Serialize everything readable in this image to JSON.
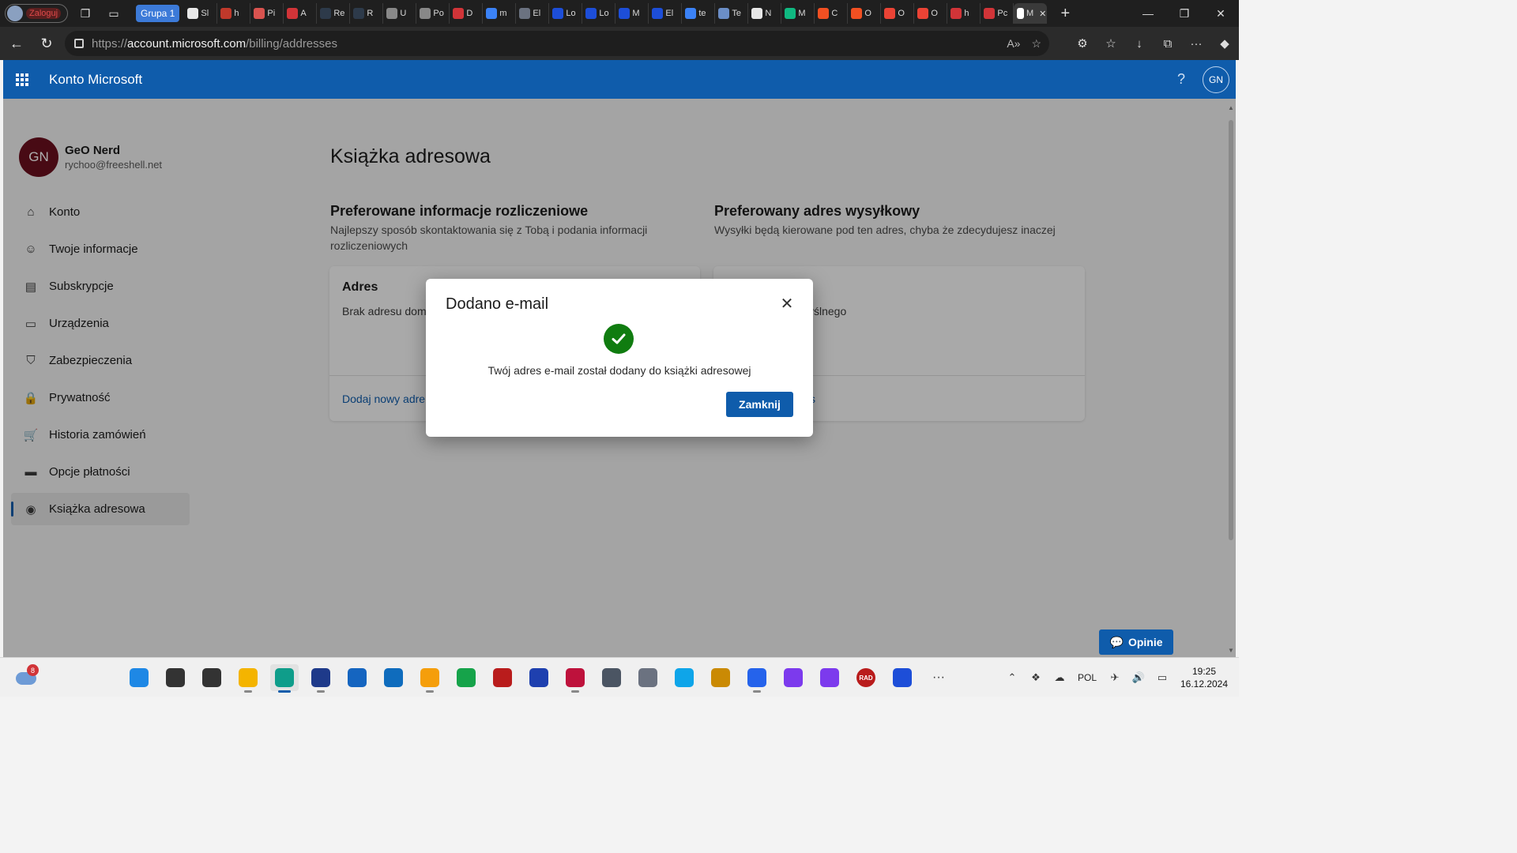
{
  "browser": {
    "profile_label": "Zaloguj",
    "group_label": "Grupa 1",
    "tabs": [
      {
        "label": "Sl",
        "color": "#e8e8e8"
      },
      {
        "label": "h",
        "color": "#c0392b"
      },
      {
        "label": "Pi",
        "color": "#d9534f"
      },
      {
        "label": "A",
        "color": "#d13438"
      },
      {
        "label": "Re",
        "color": "#2d3a4a"
      },
      {
        "label": "R",
        "color": "#2d3a4a"
      },
      {
        "label": "U",
        "color": "#888888"
      },
      {
        "label": "Po",
        "color": "#888888"
      },
      {
        "label": "D",
        "color": "#d13438"
      },
      {
        "label": "m",
        "color": "#3b82f6"
      },
      {
        "label": "El",
        "color": "#6b7280"
      },
      {
        "label": "Lo",
        "color": "#1d4ed8"
      },
      {
        "label": "Lo",
        "color": "#1d4ed8"
      },
      {
        "label": "M",
        "color": "#1d4ed8"
      },
      {
        "label": "El",
        "color": "#1d4ed8"
      },
      {
        "label": "te",
        "color": "#3b82f6"
      },
      {
        "label": "Te",
        "color": "#6b8ec7"
      },
      {
        "label": "N",
        "color": "#e8e8e8"
      },
      {
        "label": "M",
        "color": "#10b981"
      },
      {
        "label": "C",
        "color": "#f25022"
      },
      {
        "label": "O",
        "color": "#f25022"
      },
      {
        "label": "O",
        "color": "#ea4335"
      },
      {
        "label": "O",
        "color": "#ea4335"
      },
      {
        "label": "h",
        "color": "#d13438"
      },
      {
        "label": "Pc",
        "color": "#d13438"
      },
      {
        "label": "M",
        "color": "#ffffff",
        "active": true
      }
    ],
    "url_prefix": "https://",
    "url_host": "account.microsoft.com",
    "url_path": "/billing/addresses"
  },
  "header": {
    "brand": "Konto Microsoft",
    "help": "?",
    "avatar_initials": "GN"
  },
  "user": {
    "initials": "GN",
    "name": "GeO Nerd",
    "email": "rychoo@freeshell.net"
  },
  "sidebar": {
    "items": [
      {
        "label": "Konto",
        "icon": "home-icon"
      },
      {
        "label": "Twoje informacje",
        "icon": "person-icon"
      },
      {
        "label": "Subskrypcje",
        "icon": "subscriptions-icon"
      },
      {
        "label": "Urządzenia",
        "icon": "device-icon"
      },
      {
        "label": "Zabezpieczenia",
        "icon": "shield-icon"
      },
      {
        "label": "Prywatność",
        "icon": "lock-icon"
      },
      {
        "label": "Historia zamówień",
        "icon": "cart-icon"
      },
      {
        "label": "Opcje płatności",
        "icon": "card-icon"
      },
      {
        "label": "Książka adresowa",
        "icon": "location-icon",
        "active": true
      }
    ]
  },
  "main": {
    "title": "Książka adresowa",
    "billing": {
      "heading": "Preferowane informacje rozliczeniowe",
      "description": "Najlepszy sposób skontaktowania się z Tobą i podania informacji rozliczeniowych",
      "card_title": "Adres",
      "card_body": "Brak adresu dom",
      "card_link": "Dodaj nowy adre"
    },
    "shipping": {
      "heading": "Preferowany adres wysyłkowy",
      "description": "Wysyłki będą kierowane pod ten adres, chyba że zdecydujesz inaczej",
      "card_body": "yślnego",
      "card_link": "s"
    },
    "feedback_label": "Opinie"
  },
  "dialog": {
    "title": "Dodano e-mail",
    "message": "Twój adres e-mail został dodany do książki adresowej",
    "button": "Zamknij"
  },
  "taskbar": {
    "weather_badge": "8",
    "apps": [
      {
        "name": "start-button",
        "color": "#1e88e5"
      },
      {
        "name": "search-button",
        "color": "#333333"
      },
      {
        "name": "task-view-button",
        "color": "#333333"
      },
      {
        "name": "file-explorer",
        "color": "#f4b400",
        "running": true
      },
      {
        "name": "edge-browser",
        "color": "#0f9d8a",
        "running": true,
        "focused": true
      },
      {
        "name": "save-app",
        "color": "#1e3a8a",
        "running": true
      },
      {
        "name": "store-app",
        "color": "#1565c0"
      },
      {
        "name": "outlook-app",
        "color": "#0f6cbd"
      },
      {
        "name": "git-app",
        "color": "#f59e0b",
        "running": true
      },
      {
        "name": "globe-app",
        "color": "#16a34a"
      },
      {
        "name": "red-app",
        "color": "#b91c1c"
      },
      {
        "name": "virtualbox-app",
        "color": "#1e40af"
      },
      {
        "name": "red-square-app",
        "color": "#be123c",
        "running": true
      },
      {
        "name": "network-app",
        "color": "#4b5563"
      },
      {
        "name": "settings-app",
        "color": "#6b7280"
      },
      {
        "name": "vscode-app",
        "color": "#0ea5e9"
      },
      {
        "name": "tools-app",
        "color": "#ca8a04"
      },
      {
        "name": "dropbox-app",
        "color": "#2563eb",
        "running": true
      },
      {
        "name": "tor-app",
        "color": "#7c3aed"
      },
      {
        "name": "github-app",
        "color": "#7c3aed"
      },
      {
        "name": "rad-app",
        "color": "#b91c1c"
      },
      {
        "name": "defender-app",
        "color": "#1d4ed8"
      },
      {
        "name": "more-apps",
        "color": "#333333"
      }
    ],
    "rad_label": "RAD",
    "language": "POL",
    "time": "19:25",
    "date": "16.12.2024"
  },
  "colors": {
    "accent": "#0f5cab",
    "success": "#107c10",
    "avatar": "#6b0f1e"
  }
}
